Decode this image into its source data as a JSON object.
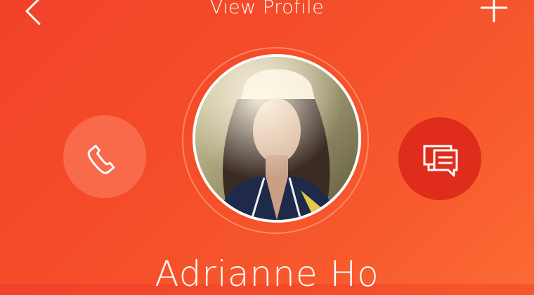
{
  "header": {
    "title": "View Profile",
    "back_icon": "chevron-left-icon",
    "add_icon": "plus-icon"
  },
  "actions": {
    "call_icon": "phone-icon",
    "message_icon": "chat-bubbles-icon"
  },
  "profile": {
    "name": "Adrianne Ho"
  },
  "colors": {
    "background_start": "#f2422a",
    "background_end": "#fb6a34",
    "call_button": "#f96a4b",
    "message_button": "#e02c1a",
    "text": "#ffffff"
  }
}
